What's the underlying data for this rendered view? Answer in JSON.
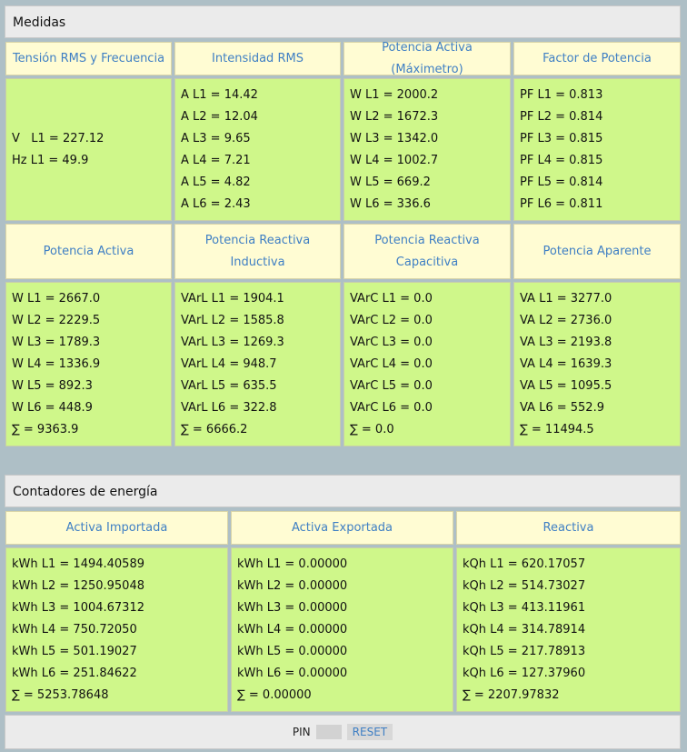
{
  "medidas": {
    "title": "Medidas",
    "row1": [
      {
        "header": "Tensión RMS y Frecuencia",
        "lines": [
          "V   L1 = 227.12",
          "Hz L1 = 49.9"
        ]
      },
      {
        "header": "Intensidad RMS",
        "lines": [
          "A L1 = 14.42",
          "A L2 = 12.04",
          "A L3 = 9.65",
          "A L4 = 7.21",
          "A L5 = 4.82",
          "A L6 = 2.43"
        ]
      },
      {
        "header": "Potencia Activa (Máximetro)",
        "lines": [
          "W L1 = 2000.2",
          "W L2 = 1672.3",
          "W L3 = 1342.0",
          "W L4 = 1002.7",
          "W L5 = 669.2",
          "W L6 = 336.6"
        ]
      },
      {
        "header": "Factor de Potencia",
        "lines": [
          "PF L1 = 0.813",
          "PF L2 = 0.814",
          "PF L3 = 0.815",
          "PF L4 = 0.815",
          "PF L5 = 0.814",
          "PF L6 = 0.811"
        ]
      }
    ],
    "row2": [
      {
        "header": "Potencia Activa",
        "lines": [
          "W L1 = 2667.0",
          "W L2 = 2229.5",
          "W L3 = 1789.3",
          "W L4 = 1336.9",
          "W L5 = 892.3",
          "W L6 = 448.9",
          "∑ = 9363.9"
        ]
      },
      {
        "header": "Potencia Reactiva Inductiva",
        "lines": [
          "VArL L1 = 1904.1",
          "VArL L2 = 1585.8",
          "VArL L3 = 1269.3",
          "VArL L4 = 948.7",
          "VArL L5 = 635.5",
          "VArL L6 = 322.8",
          "∑ = 6666.2"
        ]
      },
      {
        "header": "Potencia Reactiva Capacitiva",
        "lines": [
          "VArC L1 = 0.0",
          "VArC L2 = 0.0",
          "VArC L3 = 0.0",
          "VArC L4 = 0.0",
          "VArC L5 = 0.0",
          "VArC L6 = 0.0",
          "∑ = 0.0"
        ]
      },
      {
        "header": "Potencia Aparente",
        "lines": [
          "VA L1 = 3277.0",
          "VA L2 = 2736.0",
          "VA L3 = 2193.8",
          "VA L4 = 1639.3",
          "VA L5 = 1095.5",
          "VA L6 = 552.9",
          "∑ = 11494.5"
        ]
      }
    ]
  },
  "contadores": {
    "title": "Contadores de energía",
    "columns": [
      {
        "header": "Activa Importada",
        "lines": [
          "kWh L1 = 1494.40589",
          "kWh L2 = 1250.95048",
          "kWh L3 = 1004.67312",
          "kWh L4 = 750.72050",
          "kWh L5 = 501.19027",
          "kWh L6 = 251.84622",
          "∑ = 5253.78648"
        ]
      },
      {
        "header": "Activa Exportada",
        "lines": [
          "kWh L1 = 0.00000",
          "kWh L2 = 0.00000",
          "kWh L3 = 0.00000",
          "kWh L4 = 0.00000",
          "kWh L5 = 0.00000",
          "kWh L6 = 0.00000",
          "∑ = 0.00000"
        ]
      },
      {
        "header": "Reactiva",
        "lines": [
          "kQh L1 = 620.17057",
          "kQh L2 = 514.73027",
          "kQh L3 = 413.11961",
          "kQh L4 = 314.78914",
          "kQh L5 = 217.78913",
          "kQh L6 = 127.37960",
          "∑ = 2207.97832"
        ]
      }
    ]
  },
  "footer": {
    "pin_label": "PIN",
    "pin_value": "",
    "reset_label": "RESET"
  }
}
